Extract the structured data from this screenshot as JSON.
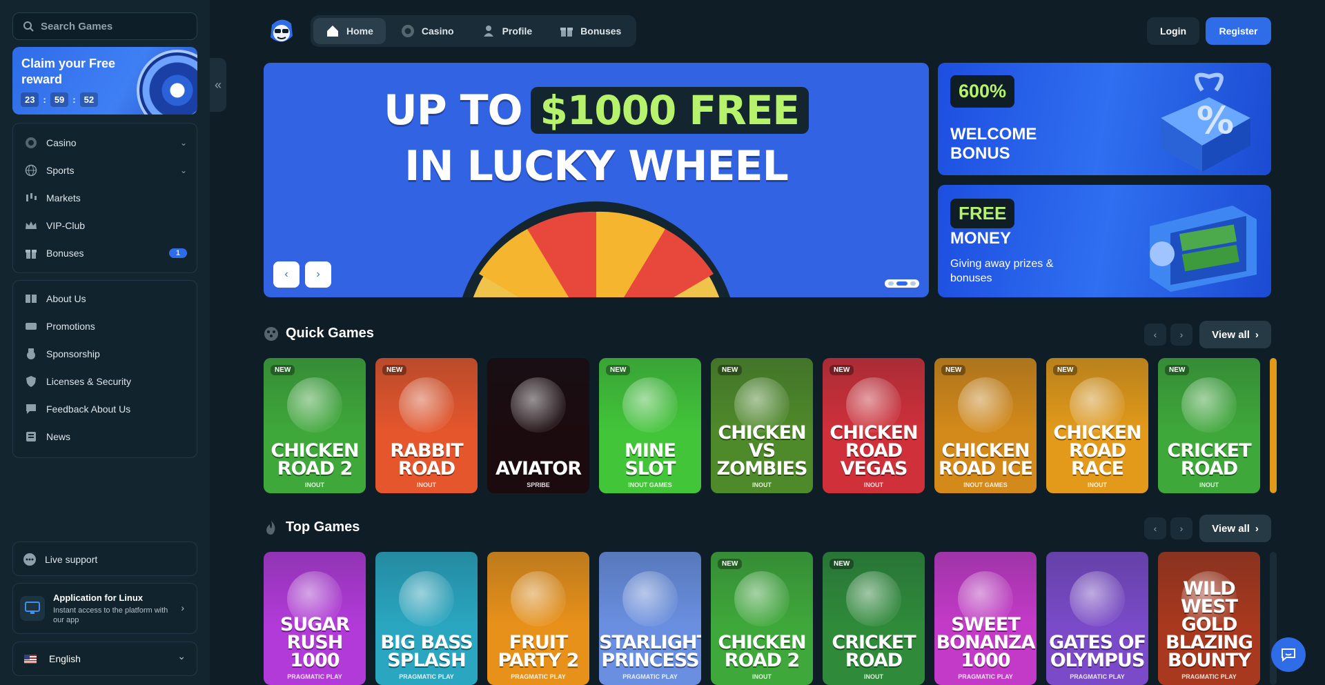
{
  "search": {
    "placeholder": "Search Games"
  },
  "claim": {
    "title": "Claim your Free reward",
    "timer": [
      "23",
      "59",
      "52"
    ]
  },
  "sidebar": {
    "main": [
      {
        "label": "Casino",
        "has_chevron": true
      },
      {
        "label": "Sports",
        "has_chevron": true
      },
      {
        "label": "Markets"
      },
      {
        "label": "VIP-Club"
      },
      {
        "label": "Bonuses",
        "badge": "1"
      }
    ],
    "info": [
      {
        "label": "About Us"
      },
      {
        "label": "Promotions"
      },
      {
        "label": "Sponsorship"
      },
      {
        "label": "Licenses & Security"
      },
      {
        "label": "Feedback About Us"
      },
      {
        "label": "News"
      }
    ],
    "live_support": "Live support",
    "app": {
      "title": "Application for Linux",
      "subtitle": "Instant access to the platform with our app"
    },
    "language": "English"
  },
  "topnav": {
    "tabs": [
      "Home",
      "Casino",
      "Profile",
      "Bonuses"
    ],
    "active": "Home"
  },
  "auth": {
    "login": "Login",
    "register": "Register"
  },
  "hero": {
    "line1a": "UP TO",
    "line1b": "$1000 FREE",
    "line2": "IN LUCKY WHEEL"
  },
  "promo1": {
    "badge": "600%",
    "title": "WELCOME BONUS"
  },
  "promo2": {
    "badge": "FREE",
    "title": "MONEY",
    "subtitle": "Giving away prizes & bonuses"
  },
  "quick": {
    "title": "Quick Games",
    "view_all": "View all",
    "games": [
      {
        "name": "CHICKEN ROAD 2",
        "provider": "INOUT",
        "new": true,
        "color": "#3fa83a"
      },
      {
        "name": "RABBIT ROAD",
        "provider": "INOUT",
        "new": true,
        "color": "#e5562c"
      },
      {
        "name": "AVIATOR",
        "provider": "SPRIBE",
        "new": false,
        "color": "#1b0b0f"
      },
      {
        "name": "MINE SLOT",
        "provider": "INOUT GAMES",
        "new": true,
        "color": "#43c53a"
      },
      {
        "name": "CHICKEN VS ZOMBIES",
        "provider": "INOUT",
        "new": true,
        "color": "#4f8a2a"
      },
      {
        "name": "CHICKEN ROAD VEGAS",
        "provider": "INOUT",
        "new": true,
        "color": "#d0303a"
      },
      {
        "name": "CHICKEN ROAD ICE",
        "provider": "INOUT GAMES",
        "new": true,
        "color": "#d48a1a"
      },
      {
        "name": "CHICKEN ROAD RACE",
        "provider": "INOUT",
        "new": true,
        "color": "#e39a1a"
      },
      {
        "name": "CRICKET ROAD",
        "provider": "INOUT",
        "new": true,
        "color": "#3fa83a"
      }
    ]
  },
  "top": {
    "title": "Top Games",
    "view_all": "View all",
    "games": [
      {
        "name": "SUGAR RUSH 1000",
        "provider": "PRAGMATIC PLAY",
        "new": false,
        "color": "#b23ad8"
      },
      {
        "name": "BIG BASS SPLASH",
        "provider": "PRAGMATIC PLAY",
        "new": false,
        "color": "#2aa6c0"
      },
      {
        "name": "FRUIT PARTY 2",
        "provider": "PRAGMATIC PLAY",
        "new": false,
        "color": "#e8911a"
      },
      {
        "name": "STARLIGHT PRINCESS",
        "provider": "PRAGMATIC PLAY",
        "new": false,
        "color": "#6a8fe0"
      },
      {
        "name": "CHICKEN ROAD 2",
        "provider": "INOUT",
        "new": true,
        "color": "#3fa83a"
      },
      {
        "name": "CRICKET ROAD",
        "provider": "INOUT",
        "new": true,
        "color": "#2f8a3a"
      },
      {
        "name": "SWEET BONANZA 1000",
        "provider": "PRAGMATIC PLAY",
        "new": false,
        "color": "#c43ac8"
      },
      {
        "name": "GATES OF OLYMPUS",
        "provider": "PRAGMATIC PLAY",
        "new": false,
        "color": "#7a4ac8"
      },
      {
        "name": "WILD WEST GOLD BLAZING BOUNTY",
        "provider": "PRAGMATIC PLAY",
        "new": false,
        "color": "#a8381e"
      }
    ]
  },
  "colors": {
    "accent": "#2f6ce8",
    "bg": "#0e1d26",
    "sidebar": "#132630",
    "green_text": "#b6f26c"
  }
}
